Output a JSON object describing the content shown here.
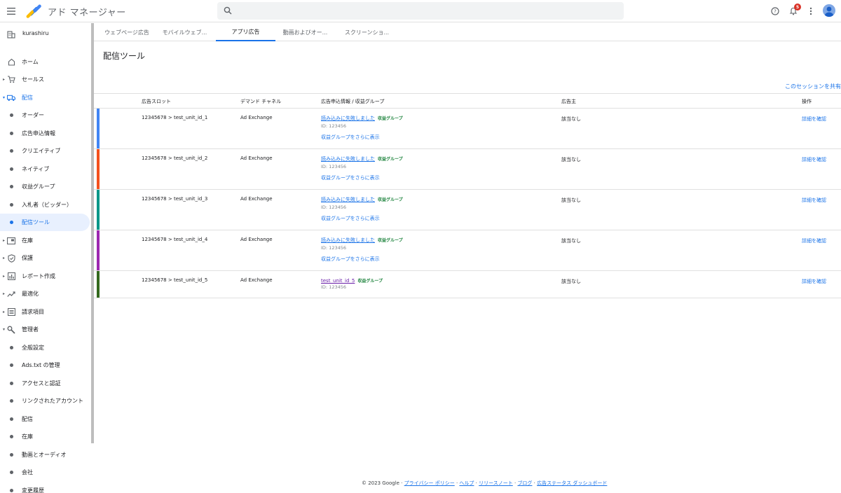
{
  "app": {
    "title": "アド マネージャー"
  },
  "notifications": {
    "count": "5"
  },
  "network": {
    "name": "kurashiru"
  },
  "sidebar": {
    "items": [
      {
        "label": "ホーム"
      },
      {
        "label": "セールス"
      },
      {
        "label": "配信"
      },
      {
        "label": "オーダー"
      },
      {
        "label": "広告申込情報"
      },
      {
        "label": "クリエイティブ"
      },
      {
        "label": "ネイティブ"
      },
      {
        "label": "収益グループ"
      },
      {
        "label": "入札者（ビッダー）"
      },
      {
        "label": "配信ツール"
      },
      {
        "label": "在庫"
      },
      {
        "label": "保護"
      },
      {
        "label": "レポート作成"
      },
      {
        "label": "最適化"
      },
      {
        "label": "請求項目"
      },
      {
        "label": "管理者"
      },
      {
        "label": "全般設定"
      },
      {
        "label": "Ads.txt の管理"
      },
      {
        "label": "アクセスと認証"
      },
      {
        "label": "リンクされたアカウント"
      },
      {
        "label": "配信"
      },
      {
        "label": "在庫"
      },
      {
        "label": "動画とオーディオ"
      },
      {
        "label": "会社"
      },
      {
        "label": "変更履歴"
      }
    ]
  },
  "tabs": [
    {
      "label": "ウェブページ広告"
    },
    {
      "label": "モバイルウェブ..."
    },
    {
      "label": "アプリ広告"
    },
    {
      "label": "動画およびオー..."
    },
    {
      "label": "スクリーンショ..."
    }
  ],
  "page": {
    "title": "配信ツール",
    "share": "このセッションを共有"
  },
  "table": {
    "headers": {
      "slot": "広告スロット",
      "channel": "デマンド チャネル",
      "lineitem": "広告申込情報 / 収益グループ",
      "advertiser": "広告主",
      "action": "操作"
    },
    "rows": [
      {
        "color": "#4285f4",
        "slot": "12345678 > test_unit_id_1",
        "channel": "Ad Exchange",
        "line": "読み込みに失敗しました",
        "tag": "収益グループ",
        "id": "ID: 123456",
        "more": "収益グループをさらに表示",
        "advertiser": "該当なし",
        "action": "詳細を確認"
      },
      {
        "color": "#f4511e",
        "slot": "12345678 > test_unit_id_2",
        "channel": "Ad Exchange",
        "line": "読み込みに失敗しました",
        "tag": "収益グループ",
        "id": "ID: 123456",
        "more": "収益グループをさらに表示",
        "advertiser": "該当なし",
        "action": "詳細を確認"
      },
      {
        "color": "#009688",
        "slot": "12345678 > test_unit_id_3",
        "channel": "Ad Exchange",
        "line": "読み込みに失敗しました",
        "tag": "収益グループ",
        "id": "ID: 123456",
        "more": "収益グループをさらに表示",
        "advertiser": "該当なし",
        "action": "詳細を確認"
      },
      {
        "color": "#9c27b0",
        "slot": "12345678 > test_unit_id_4",
        "channel": "Ad Exchange",
        "line": "読み込みに失敗しました",
        "tag": "収益グループ",
        "id": "ID: 123456",
        "more": "収益グループをさらに表示",
        "advertiser": "該当なし",
        "action": "詳細を確認"
      },
      {
        "color": "#33691e",
        "slot": "12345678 > test_unit_id_5",
        "channel": "Ad Exchange",
        "line": "test_unit_id_5",
        "tag": "収益グループ",
        "id": "ID: 123456",
        "advertiser": "該当なし",
        "action": "詳細を確認"
      }
    ]
  },
  "footer": {
    "copyright": "© 2023 Google · ",
    "privacy": "プライバシー ポリシー",
    "help": "ヘルプ",
    "release": "リリースノート",
    "blog": "ブログ",
    "status": "広告ステータス ダッシュボード"
  }
}
